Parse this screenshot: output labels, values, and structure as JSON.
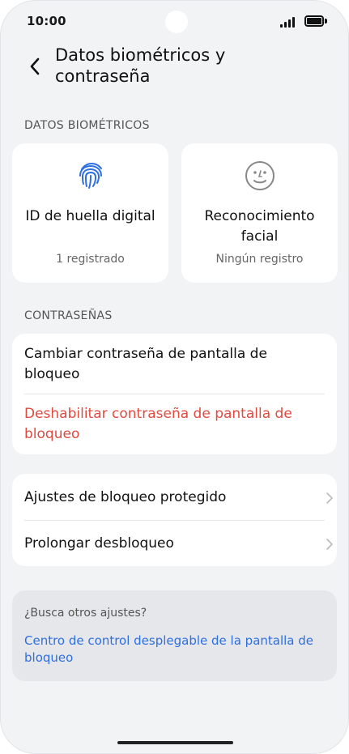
{
  "status": {
    "time": "10:00"
  },
  "header": {
    "title": "Datos biométricos y contraseña"
  },
  "biometrics": {
    "section_label": "DATOS BIOMÉTRICOS",
    "fingerprint": {
      "name": "ID de huella digital",
      "status": "1 registrado",
      "icon": "fingerprint-icon"
    },
    "face": {
      "name": "Reconocimiento facial",
      "status": "Ningún registro",
      "icon": "face-icon"
    }
  },
  "passwords": {
    "section_label": "CONTRASEÑAS",
    "change": "Cambiar contraseña de pantalla de bloqueo",
    "disable": "Deshabilitar contraseña de pantalla de bloqueo"
  },
  "settings": {
    "secure_lock": "Ajustes de bloqueo protegido",
    "extend_unlock": "Prolongar desbloqueo"
  },
  "tip": {
    "question": "¿Busca otros ajustes?",
    "link": "Centro de control desplegable de la pantalla de bloqueo"
  },
  "colors": {
    "accent": "#2f6fe0",
    "danger": "#e04a3f",
    "background": "#f1f3f5"
  }
}
